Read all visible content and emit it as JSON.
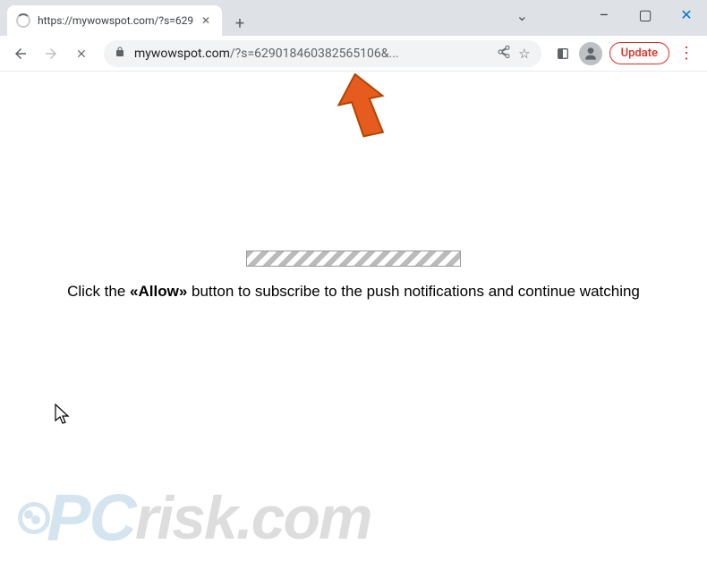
{
  "window": {
    "tab_title": "https://mywowspot.com/?s=629",
    "minimize_glyph": "–",
    "maximize_glyph": "▢",
    "close_glyph": "✕",
    "chevron_glyph": "⌄",
    "new_tab_glyph": "+"
  },
  "toolbar": {
    "lock_glyph": "🔒",
    "url_domain": "mywowspot.com",
    "url_path": "/?s=629018460382565106&...",
    "share_glyph": "⇪",
    "star_glyph": "☆",
    "ext_glyph": "◧",
    "update_label": "Update",
    "menu_glyph": "⋮"
  },
  "page": {
    "text_prefix": "Click the ",
    "text_allow": "«Allow»",
    "text_suffix": " button to subscribe to the push notifications and continue watching"
  },
  "watermark": {
    "pc": "PC",
    "rest": "risk.com"
  }
}
